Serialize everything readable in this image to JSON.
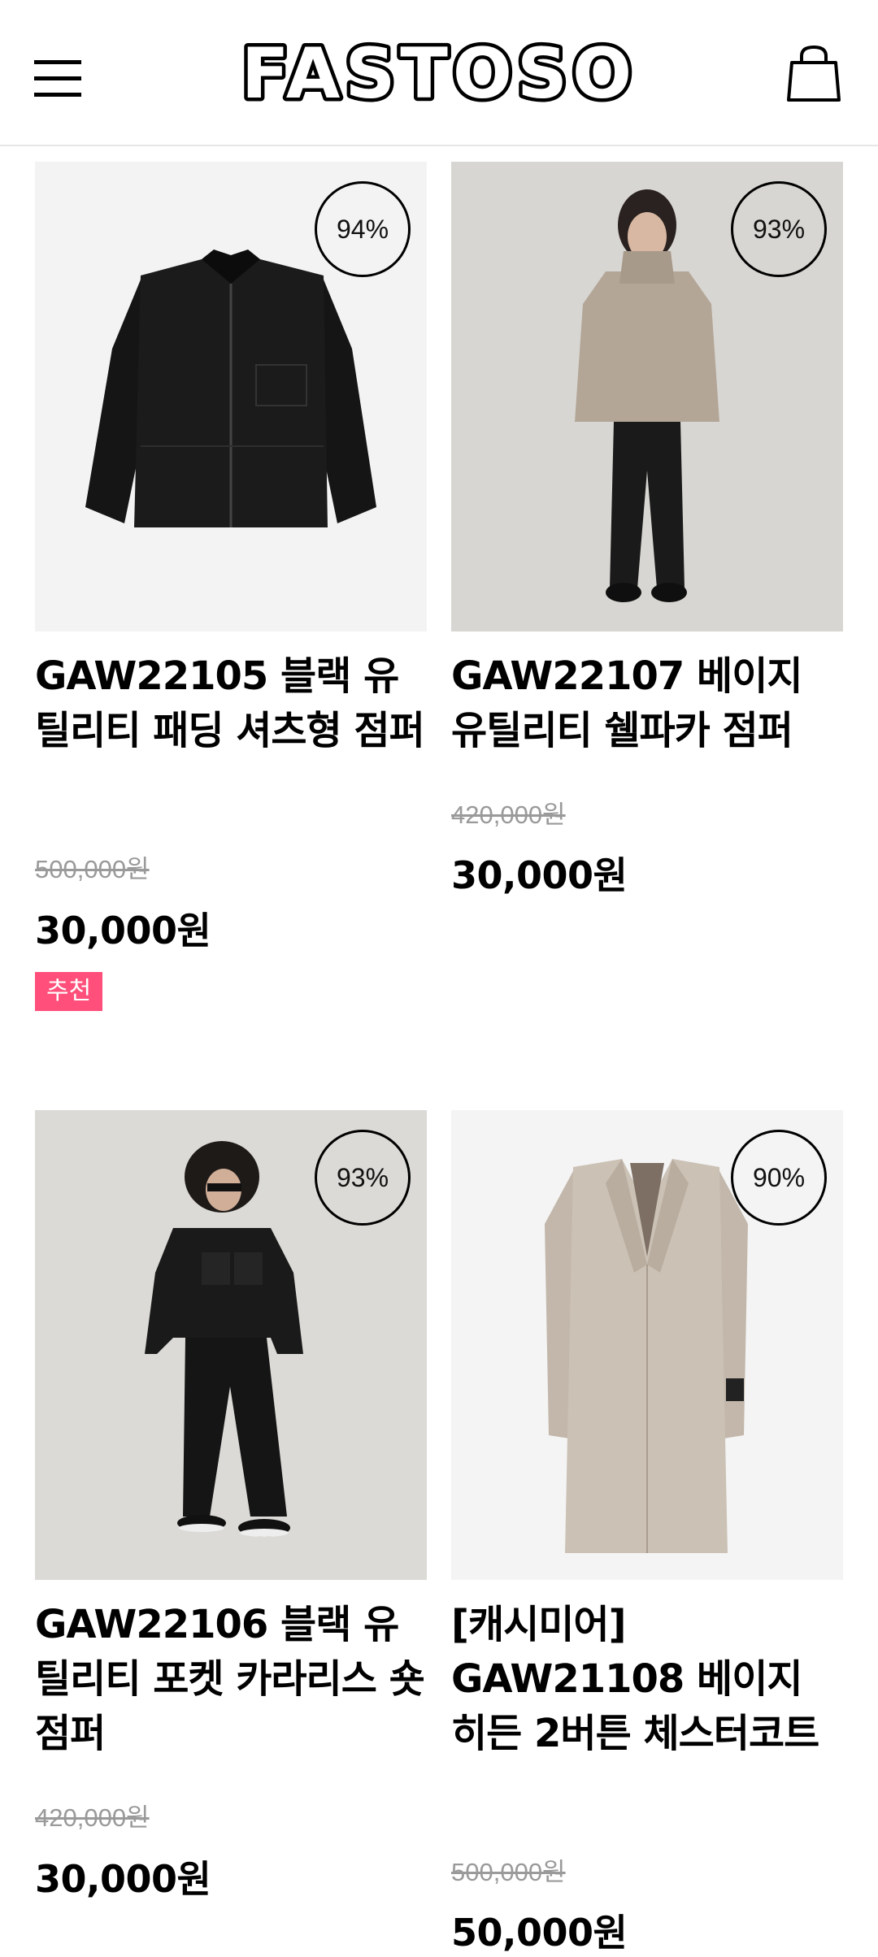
{
  "header": {
    "menu_icon": "hamburger-menu-icon",
    "logo_text": "FASTOSO",
    "cart_icon": "shopping-bag-icon"
  },
  "products": [
    {
      "discount": "94%",
      "name": "GAW22105 블랙 유틸리티 패딩 셔츠형 점퍼",
      "original_price": "500,000원",
      "price": "30,000원",
      "tag": "추천",
      "image": "black-padded-shirt-jacket"
    },
    {
      "discount": "93%",
      "name": "GAW22107 베이지 유틸리티 쉘파카 점퍼",
      "original_price": "420,000원",
      "price": "30,000원",
      "image": "model-in-beige-parka"
    },
    {
      "discount": "93%",
      "name": "GAW22106 블랙 유틸리티 포켓 카라리스 숏점퍼",
      "original_price": "420,000원",
      "price": "30,000원",
      "image": "model-in-black-pocket-jacket"
    },
    {
      "discount": "90%",
      "name": "[캐시미어] GAW21108 베이지 히든 2버튼 체스터코트",
      "original_price": "500,000원",
      "price": "50,000원",
      "image": "beige-chester-coat"
    }
  ],
  "colors": {
    "tag_bg": "#ff4f7a",
    "strike_price": "#9a9a9a",
    "header_border": "#e6e6e6"
  }
}
